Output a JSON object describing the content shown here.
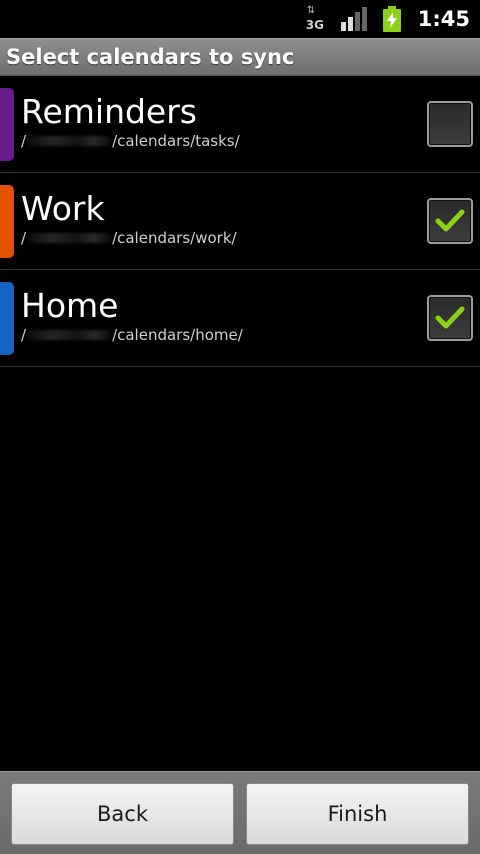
{
  "status_bar": {
    "network_type": "3G",
    "time": "1:45",
    "icons": [
      "data-activity-icon",
      "signal-icon",
      "battery-charging-icon"
    ]
  },
  "title": "Select calendars to sync",
  "calendars": [
    {
      "name": "Reminders",
      "path_prefix": "/",
      "path_suffix": "/calendars/tasks/",
      "color": "#6a1b8a",
      "checked": false
    },
    {
      "name": "Work",
      "path_prefix": "/",
      "path_suffix": "/calendars/work/",
      "color": "#e65100",
      "checked": true
    },
    {
      "name": "Home",
      "path_prefix": "/",
      "path_suffix": "/calendars/home/",
      "color": "#1565c0",
      "checked": true
    }
  ],
  "buttons": {
    "back": "Back",
    "finish": "Finish"
  },
  "colors": {
    "check": "#8bd11a",
    "title_bar": "#7f7f7f"
  }
}
